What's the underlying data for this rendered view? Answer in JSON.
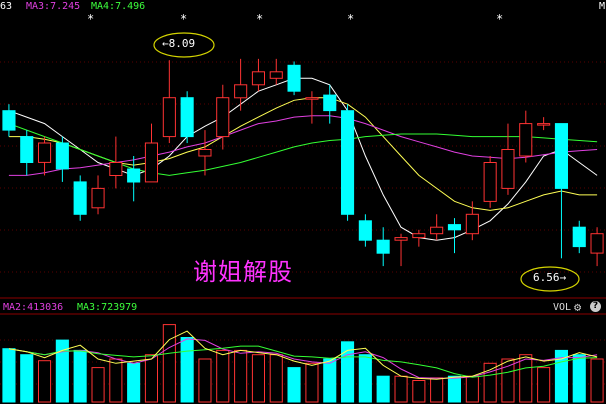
{
  "header": {
    "ma_cut": "63",
    "ma3": "MA3:7.245",
    "ma4": "MA4:7.496",
    "corner": "M"
  },
  "stars": [
    "*",
    "*",
    "*",
    "*",
    "*"
  ],
  "annotations": {
    "high": "←8.09",
    "low": "6.56→"
  },
  "watermark": "谢姐解股",
  "volume_header": {
    "ma2": "MA2:413036",
    "ma3": "MA3:723979",
    "label": "VOL"
  },
  "icons": {
    "settings": "gear-icon",
    "help": "question-icon"
  },
  "colors": {
    "up": "#ff3333",
    "down": "#00ffff",
    "ma1": "#ffffff",
    "ma2": "#ffff55",
    "ma3": "#e040e0",
    "ma4": "#33ff33",
    "grid": "#8b0000"
  },
  "chart_data": [
    {
      "type": "candlestick",
      "price_range": [
        6.3,
        8.4
      ],
      "candles": [
        {
          "o": 7.7,
          "c": 7.55,
          "h": 7.75,
          "l": 7.5
        },
        {
          "o": 7.5,
          "c": 7.3,
          "h": 7.55,
          "l": 7.2
        },
        {
          "o": 7.3,
          "c": 7.45,
          "h": 7.5,
          "l": 7.2
        },
        {
          "o": 7.45,
          "c": 7.25,
          "h": 7.5,
          "l": 7.15
        },
        {
          "o": 7.15,
          "c": 6.9,
          "h": 7.2,
          "l": 6.85
        },
        {
          "o": 6.95,
          "c": 7.1,
          "h": 7.2,
          "l": 6.9
        },
        {
          "o": 7.2,
          "c": 7.3,
          "h": 7.5,
          "l": 7.1
        },
        {
          "o": 7.25,
          "c": 7.15,
          "h": 7.35,
          "l": 7.0
        },
        {
          "o": 7.15,
          "c": 7.45,
          "h": 7.6,
          "l": 7.15
        },
        {
          "o": 7.5,
          "c": 7.8,
          "h": 8.09,
          "l": 7.45
        },
        {
          "o": 7.8,
          "c": 7.5,
          "h": 7.85,
          "l": 7.45
        },
        {
          "o": 7.35,
          "c": 7.4,
          "h": 7.55,
          "l": 7.2
        },
        {
          "o": 7.5,
          "c": 7.8,
          "h": 7.9,
          "l": 7.4
        },
        {
          "o": 7.8,
          "c": 7.9,
          "h": 8.1,
          "l": 7.7
        },
        {
          "o": 7.9,
          "c": 8.0,
          "h": 8.1,
          "l": 7.85
        },
        {
          "o": 7.95,
          "c": 8.0,
          "h": 8.1,
          "l": 7.9
        },
        {
          "o": 8.05,
          "c": 7.85,
          "h": 8.08,
          "l": 7.82
        },
        {
          "o": 7.8,
          "c": 7.8,
          "h": 7.85,
          "l": 7.6
        },
        {
          "o": 7.82,
          "c": 7.7,
          "h": 7.9,
          "l": 7.6
        },
        {
          "o": 7.7,
          "c": 6.9,
          "h": 7.75,
          "l": 6.85
        },
        {
          "o": 6.85,
          "c": 6.7,
          "h": 6.9,
          "l": 6.65
        },
        {
          "o": 6.7,
          "c": 6.6,
          "h": 6.8,
          "l": 6.5
        },
        {
          "o": 6.7,
          "c": 6.72,
          "h": 6.75,
          "l": 6.5
        },
        {
          "o": 6.72,
          "c": 6.75,
          "h": 6.78,
          "l": 6.65
        },
        {
          "o": 6.75,
          "c": 6.8,
          "h": 6.9,
          "l": 6.7
        },
        {
          "o": 6.82,
          "c": 6.78,
          "h": 6.87,
          "l": 6.6
        },
        {
          "o": 6.75,
          "c": 6.9,
          "h": 7.0,
          "l": 6.7
        },
        {
          "o": 7.0,
          "c": 7.3,
          "h": 7.35,
          "l": 6.95
        },
        {
          "o": 7.1,
          "c": 7.4,
          "h": 7.6,
          "l": 7.05
        },
        {
          "o": 7.35,
          "c": 7.6,
          "h": 7.7,
          "l": 7.3
        },
        {
          "o": 7.6,
          "c": 7.6,
          "h": 7.65,
          "l": 7.55
        },
        {
          "o": 7.6,
          "c": 7.1,
          "h": 7.6,
          "l": 6.56
        },
        {
          "o": 6.8,
          "c": 6.65,
          "h": 6.85,
          "l": 6.6
        },
        {
          "o": 6.6,
          "c": 6.75,
          "h": 6.8,
          "l": 6.5
        }
      ],
      "ma_lines": [
        {
          "color_key": "ma1",
          "values": [
            7.7,
            7.65,
            7.6,
            7.5,
            7.4,
            7.3,
            7.25,
            7.2,
            7.25,
            7.35,
            7.5,
            7.58,
            7.65,
            7.75,
            7.85,
            7.9,
            7.95,
            7.95,
            7.9,
            7.7,
            7.35,
            7.05,
            6.8,
            6.72,
            6.7,
            6.72,
            6.78,
            6.85,
            6.98,
            7.15,
            7.35,
            7.4,
            7.3,
            7.2
          ]
        },
        {
          "color_key": "ma2",
          "values": [
            7.5,
            7.5,
            7.48,
            7.45,
            7.4,
            7.35,
            7.3,
            7.28,
            7.3,
            7.33,
            7.38,
            7.42,
            7.5,
            7.58,
            7.65,
            7.72,
            7.78,
            7.8,
            7.8,
            7.75,
            7.65,
            7.5,
            7.35,
            7.2,
            7.1,
            7.0,
            6.95,
            6.93,
            6.95,
            7.0,
            7.05,
            7.08,
            7.05,
            7.05
          ]
        },
        {
          "color_key": "ma3",
          "values": [
            7.2,
            7.2,
            7.22,
            7.25,
            7.26,
            7.28,
            7.3,
            7.32,
            7.35,
            7.38,
            7.42,
            7.45,
            7.5,
            7.55,
            7.6,
            7.62,
            7.65,
            7.66,
            7.66,
            7.64,
            7.6,
            7.55,
            7.5,
            7.46,
            7.42,
            7.38,
            7.35,
            7.34,
            7.33,
            7.34,
            7.36,
            7.38,
            7.39,
            7.4
          ]
        },
        {
          "color_key": "ma4",
          "values": [
            7.6,
            7.55,
            7.5,
            7.45,
            7.4,
            7.35,
            7.3,
            7.25,
            7.22,
            7.2,
            7.22,
            7.24,
            7.27,
            7.3,
            7.34,
            7.38,
            7.42,
            7.45,
            7.47,
            7.48,
            7.5,
            7.51,
            7.52,
            7.52,
            7.52,
            7.51,
            7.5,
            7.5,
            7.5,
            7.5,
            7.49,
            7.48,
            7.47,
            7.46
          ]
        }
      ]
    },
    {
      "type": "bar",
      "title": "VOL",
      "values": [
        0.62,
        0.55,
        0.48,
        0.72,
        0.6,
        0.4,
        0.5,
        0.45,
        0.55,
        0.9,
        0.75,
        0.5,
        0.6,
        0.6,
        0.55,
        0.55,
        0.4,
        0.45,
        0.5,
        0.7,
        0.55,
        0.3,
        0.3,
        0.25,
        0.28,
        0.3,
        0.3,
        0.45,
        0.5,
        0.55,
        0.4,
        0.6,
        0.55,
        0.5
      ],
      "ylim": [
        0,
        1
      ]
    }
  ]
}
